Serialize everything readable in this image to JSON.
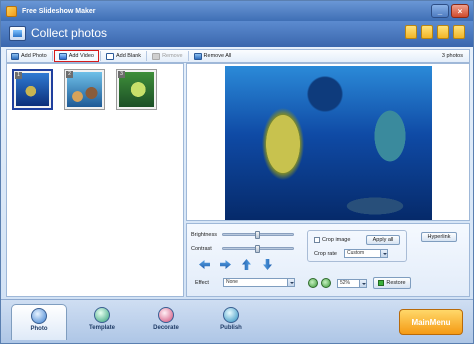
{
  "window": {
    "title": "Free Slideshow Maker"
  },
  "header": {
    "title": "Collect photos"
  },
  "toolbar": {
    "add_photo": "Add Photo",
    "add_video": "Add Video",
    "add_blank": "Add Blank",
    "remove": "Remove",
    "remove_all": "Remove All",
    "count": "3 photos"
  },
  "thumbnails": [
    {
      "number": "1"
    },
    {
      "number": "2"
    },
    {
      "number": "3"
    }
  ],
  "controls": {
    "brightness_label": "Brightness",
    "contrast_label": "Contrast",
    "effect_label": "Effect",
    "effect_value": "None",
    "crop_image_label": "Crop image",
    "apply_all": "Apply all",
    "hyperlink": "Hyperlink",
    "crop_rate_label": "Crop rate",
    "crop_rate_value": "Custom",
    "zoom_value": "52%",
    "restore": "Restore",
    "brightness_level": 0.5,
    "contrast_level": 0.5
  },
  "nav": {
    "photo": "Photo",
    "template": "Template",
    "decorate": "Decorate",
    "publish": "Publish",
    "main_menu": "MainMenu"
  },
  "colors": {
    "selected_border": "#1f3f9e",
    "active_button_border": "#d61a1a",
    "main_menu": "#f59a14"
  }
}
